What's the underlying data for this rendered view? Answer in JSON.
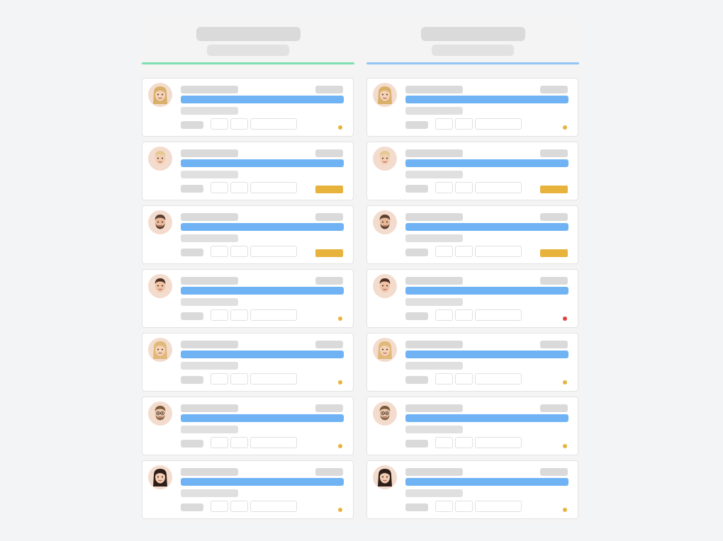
{
  "colors": {
    "page_bg": "#f3f4f6",
    "placeholder": "#dadada",
    "title_bar": "#6fb3f5",
    "amber": "#e8b33c",
    "red": "#e0413f"
  },
  "columns": [
    {
      "accent": "#7ee0b2",
      "cards": [
        {
          "avatar": "avatar-blonde-woman",
          "status": "dot",
          "status_color": "#e8b33c"
        },
        {
          "avatar": "avatar-blonde-man",
          "status": "badge",
          "status_color": "#e8b33c"
        },
        {
          "avatar": "avatar-bearded-man",
          "status": "badge",
          "status_color": "#e8b33c"
        },
        {
          "avatar": "avatar-dark-haired-man",
          "status": "dot",
          "status_color": "#e8b33c"
        },
        {
          "avatar": "avatar-blonde-woman-2",
          "status": "dot",
          "status_color": "#e8b33c"
        },
        {
          "avatar": "avatar-man-glasses",
          "status": "dot",
          "status_color": "#e8b33c"
        },
        {
          "avatar": "avatar-dark-haired-woman",
          "status": "dot",
          "status_color": "#e8b33c"
        }
      ]
    },
    {
      "accent": "#93c4f6",
      "cards": [
        {
          "avatar": "avatar-blonde-woman",
          "status": "dot",
          "status_color": "#e8b33c"
        },
        {
          "avatar": "avatar-blonde-man",
          "status": "badge",
          "status_color": "#e8b33c"
        },
        {
          "avatar": "avatar-bearded-man",
          "status": "badge",
          "status_color": "#e8b33c"
        },
        {
          "avatar": "avatar-dark-haired-man",
          "status": "dot",
          "status_color": "#e0413f"
        },
        {
          "avatar": "avatar-blonde-woman-2",
          "status": "dot",
          "status_color": "#e8b33c"
        },
        {
          "avatar": "avatar-man-glasses",
          "status": "dot",
          "status_color": "#e8b33c"
        },
        {
          "avatar": "avatar-dark-haired-woman",
          "status": "dot",
          "status_color": "#e8b33c"
        }
      ]
    }
  ]
}
